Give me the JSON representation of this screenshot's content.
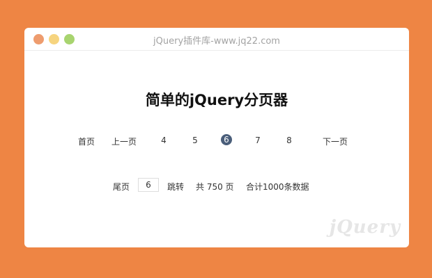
{
  "window": {
    "title": "jQuery插件库-www.jq22.com"
  },
  "heading": "简单的jQuery分页器",
  "pager": {
    "first": "首页",
    "prev": "上一页",
    "pages": [
      "4",
      "5",
      "6",
      "7",
      "8"
    ],
    "current_page": "6",
    "next": "下一页",
    "last": "尾页",
    "jump_value": "6",
    "jump_label": "跳转",
    "total_pages_text": "共 750 页",
    "total_records_text": "合计1000条数据"
  },
  "watermark": "jQuery",
  "colors": {
    "background": "#ee8544",
    "current_page_bg": "#4a5e7a",
    "dot_red": "#ee9c6e",
    "dot_yellow": "#f6d47f",
    "dot_green": "#a8d46f"
  }
}
